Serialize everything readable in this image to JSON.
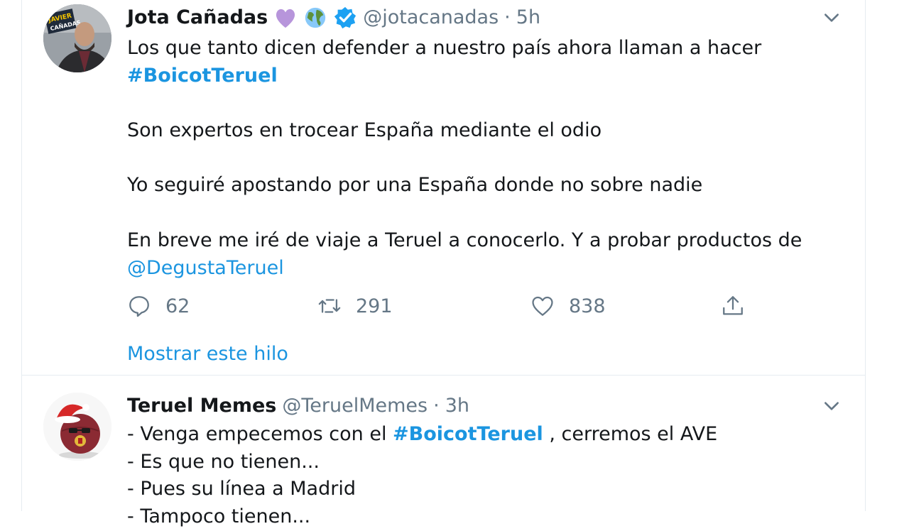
{
  "tweet1": {
    "name": "Jota Cañadas",
    "handle": "@jotacanadas",
    "separator": "·",
    "time": "5h",
    "emojis": [
      "purple-heart",
      "earth-globe",
      "verified-badge"
    ],
    "avatar_text_top": "JAVIER",
    "avatar_text_bottom": "CAÑADAS",
    "lines": {
      "l1": "Los que tanto dicen defender a nuestro país ahora llaman a hacer",
      "hashtag": "#BoicotTeruel",
      "l2": "Son expertos en trocear España mediante el odio",
      "l3": "Yo seguiré apostando por una España donde no sobre nadie",
      "l4": "En breve me iré de viaje a Teruel a conocerlo. Y a probar productos de",
      "mention": "@DegustaTeruel"
    },
    "replies": "62",
    "retweets": "291",
    "likes": "838",
    "thread_link": "Mostrar este hilo"
  },
  "tweet2": {
    "name": "Teruel Memes",
    "handle": "@TeruelMemes",
    "separator": "·",
    "time": "3h",
    "lines": {
      "l1_prefix": "- Venga empecemos con el ",
      "hashtag": "#BoicotTeruel",
      "l1_suffix": " , cerremos el AVE",
      "l2": "- Es que no tienen...",
      "l3": "- Pues su línea a Madrid",
      "l4": "- Tampoco tienen..."
    }
  },
  "colors": {
    "link": "#1b95e0",
    "secondary_text": "#657786",
    "border": "#e6ecf0"
  }
}
